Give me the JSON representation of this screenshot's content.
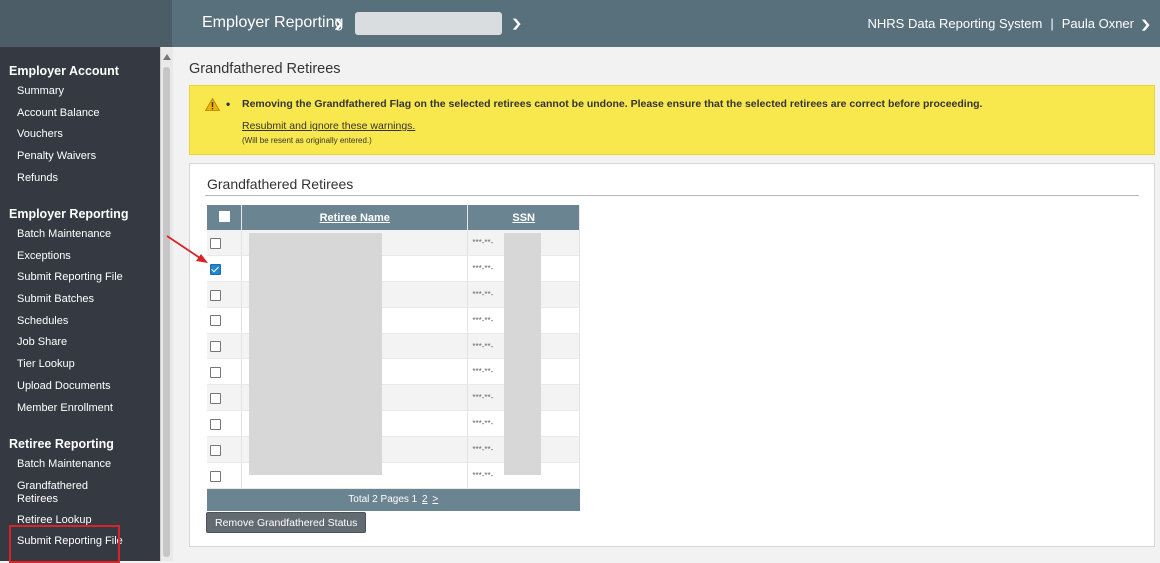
{
  "header": {
    "module_title": "Employer Reporting",
    "system_name": "NHRS Data Reporting System",
    "separator": "|",
    "user_name": "Paula Oxner"
  },
  "sidebar": {
    "sections": [
      {
        "heading": "Employer Account",
        "items": [
          "Summary",
          "Account Balance",
          "Vouchers",
          "Penalty Waivers",
          "Refunds"
        ]
      },
      {
        "heading": "Employer Reporting",
        "items": [
          "Batch Maintenance",
          "Exceptions",
          "Submit Reporting File",
          "Submit Batches",
          "Schedules",
          "Job Share",
          "Tier Lookup",
          "Upload Documents",
          "Member Enrollment"
        ]
      },
      {
        "heading": "Retiree Reporting",
        "items": [
          "Batch Maintenance",
          "Grandfathered Retirees",
          "Retiree Lookup",
          "Submit Reporting File"
        ]
      }
    ]
  },
  "page": {
    "title": "Grandfathered Retirees"
  },
  "warning": {
    "message": "Removing the Grandfathered Flag on the selected retirees cannot be undone. Please ensure that the selected retirees are correct before proceeding.",
    "link": "Resubmit and ignore these warnings.",
    "note": "(Will be resent as originally entered.)"
  },
  "panel": {
    "title": "Grandfathered Retirees",
    "columns": [
      "Retiree Name",
      "SSN"
    ],
    "rows": [
      {
        "checked": false,
        "ssn": "***-**-"
      },
      {
        "checked": true,
        "ssn": "***-**-"
      },
      {
        "checked": false,
        "ssn": "***-**-"
      },
      {
        "checked": false,
        "ssn": "***-**-"
      },
      {
        "checked": false,
        "ssn": "***-**-"
      },
      {
        "checked": false,
        "ssn": "***-**-"
      },
      {
        "checked": false,
        "ssn": "***-**-"
      },
      {
        "checked": false,
        "ssn": "***-**-"
      },
      {
        "checked": false,
        "ssn": "***-**-"
      },
      {
        "checked": false,
        "ssn": "***-**-"
      }
    ],
    "pager": {
      "summary": "Total 2 Pages",
      "current": "1",
      "next_page": "2",
      "next": ">"
    },
    "remove_button": "Remove Grandfathered Status"
  },
  "colors": {
    "topbar": "#586f7c",
    "sidebar": "#353a42",
    "warning_bg": "#f9e84d",
    "grid_header": "#6b8492",
    "annotation_red": "#d8232a"
  }
}
